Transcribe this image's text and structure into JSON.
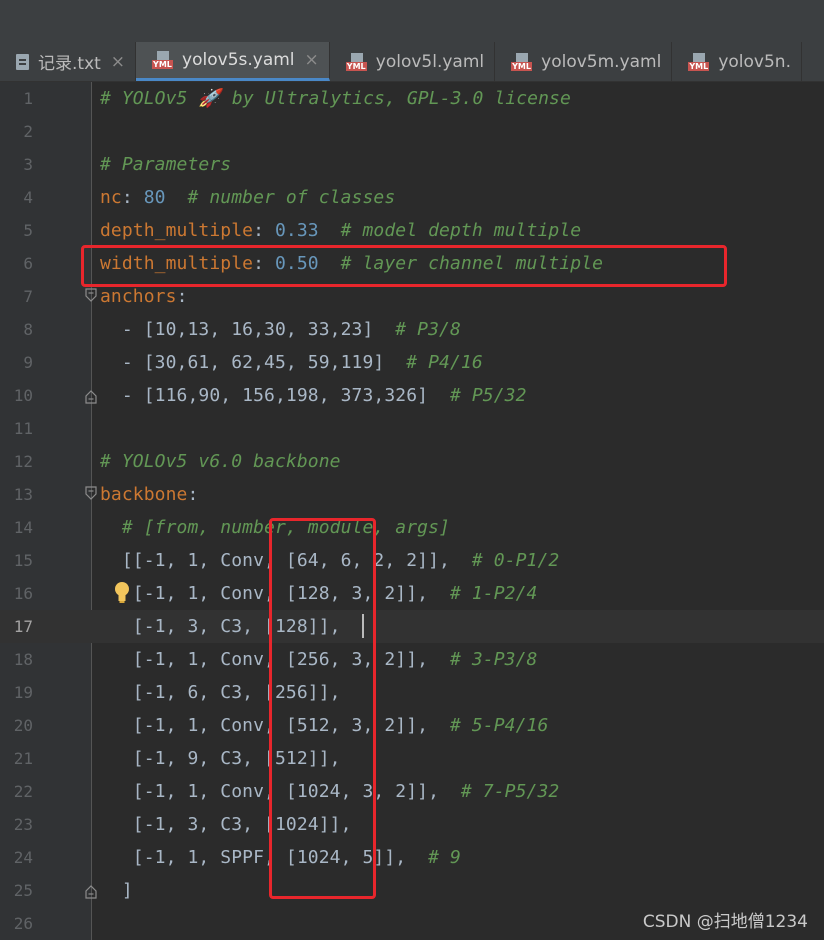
{
  "tabs": [
    {
      "name": "记录.txt",
      "icon": "text-file-icon",
      "active": false,
      "close": "×"
    },
    {
      "name": "yolov5s.yaml",
      "icon": "yaml-file-icon",
      "active": true,
      "close": "×"
    },
    {
      "name": "yolov5l.yaml",
      "icon": "yaml-file-icon",
      "active": false,
      "close": ""
    },
    {
      "name": "yolov5m.yaml",
      "icon": "yaml-file-icon",
      "active": false,
      "close": ""
    },
    {
      "name": "yolov5n.",
      "icon": "yaml-file-icon",
      "active": false,
      "close": ""
    }
  ],
  "yaml_badge": "YML",
  "current_line": 17,
  "lines": [
    {
      "n": "1",
      "tokens": [
        [
          "c",
          "# YOLOv5 🚀 by Ultralytics, GPL-3.0 license"
        ]
      ]
    },
    {
      "n": "2",
      "tokens": []
    },
    {
      "n": "3",
      "tokens": [
        [
          "c",
          "# Parameters"
        ]
      ]
    },
    {
      "n": "4",
      "tokens": [
        [
          "k",
          "nc"
        ],
        [
          "t",
          ": "
        ],
        [
          "n",
          "80"
        ],
        [
          "t",
          "  "
        ],
        [
          "c",
          "# number of classes"
        ]
      ]
    },
    {
      "n": "5",
      "tokens": [
        [
          "k",
          "depth_multiple"
        ],
        [
          "t",
          ": "
        ],
        [
          "n",
          "0.33"
        ],
        [
          "t",
          "  "
        ],
        [
          "c",
          "# model depth multiple"
        ]
      ]
    },
    {
      "n": "6",
      "tokens": [
        [
          "k",
          "width_multiple"
        ],
        [
          "t",
          ": "
        ],
        [
          "n",
          "0.50"
        ],
        [
          "t",
          "  "
        ],
        [
          "c",
          "# layer channel multiple"
        ]
      ]
    },
    {
      "n": "7",
      "tokens": [
        [
          "k",
          "anchors"
        ],
        [
          "t",
          ":"
        ]
      ],
      "fold": "open"
    },
    {
      "n": "8",
      "tokens": [
        [
          "t",
          "  - [10,13, 16,30, 33,23]  "
        ],
        [
          "c",
          "# P3/8"
        ]
      ]
    },
    {
      "n": "9",
      "tokens": [
        [
          "t",
          "  - [30,61, 62,45, 59,119]  "
        ],
        [
          "c",
          "# P4/16"
        ]
      ]
    },
    {
      "n": "10",
      "tokens": [
        [
          "t",
          "  - [116,90, 156,198, 373,326]  "
        ],
        [
          "c",
          "# P5/32"
        ]
      ],
      "fold": "close"
    },
    {
      "n": "11",
      "tokens": []
    },
    {
      "n": "12",
      "tokens": [
        [
          "c",
          "# YOLOv5 v6.0 backbone"
        ]
      ]
    },
    {
      "n": "13",
      "tokens": [
        [
          "k",
          "backbone"
        ],
        [
          "t",
          ":"
        ]
      ],
      "fold": "open"
    },
    {
      "n": "14",
      "tokens": [
        [
          "t",
          "  "
        ],
        [
          "c",
          "# [from, number, module, args]"
        ]
      ]
    },
    {
      "n": "15",
      "tokens": [
        [
          "t",
          "  [[-1, 1, Conv, [64, 6, 2, 2]],  "
        ],
        [
          "c",
          "# 0-P1/2"
        ]
      ]
    },
    {
      "n": "16",
      "tokens": [
        [
          "t",
          "   [-1, 1, Conv, [128, 3, 2]],  "
        ],
        [
          "c",
          "# 1-P2/4"
        ]
      ],
      "bulb": true
    },
    {
      "n": "17",
      "tokens": [
        [
          "t",
          "   [-1, 3, C3, [128]],"
        ]
      ],
      "caret": true
    },
    {
      "n": "18",
      "tokens": [
        [
          "t",
          "   [-1, 1, Conv, [256, 3, 2]],  "
        ],
        [
          "c",
          "# 3-P3/8"
        ]
      ]
    },
    {
      "n": "19",
      "tokens": [
        [
          "t",
          "   [-1, 6, C3, [256]],"
        ]
      ]
    },
    {
      "n": "20",
      "tokens": [
        [
          "t",
          "   [-1, 1, Conv, [512, 3, 2]],  "
        ],
        [
          "c",
          "# 5-P4/16"
        ]
      ]
    },
    {
      "n": "21",
      "tokens": [
        [
          "t",
          "   [-1, 9, C3, [512]],"
        ]
      ]
    },
    {
      "n": "22",
      "tokens": [
        [
          "t",
          "   [-1, 1, Conv, [1024, 3, 2]],  "
        ],
        [
          "c",
          "# 7-P5/32"
        ]
      ]
    },
    {
      "n": "23",
      "tokens": [
        [
          "t",
          "   [-1, 3, C3, [1024]],"
        ]
      ]
    },
    {
      "n": "24",
      "tokens": [
        [
          "t",
          "   [-1, 1, SPPF, [1024, 5]],  "
        ],
        [
          "c",
          "# 9"
        ]
      ]
    },
    {
      "n": "25",
      "tokens": [
        [
          "t",
          "  ]"
        ]
      ],
      "fold": "close"
    },
    {
      "n": "26",
      "tokens": []
    }
  ],
  "watermark": "CSDN @扫地僧1234",
  "colors": {
    "background": "#2b2b2b",
    "gutter": "#313335",
    "comment": "#629755",
    "key": "#cc7832",
    "number": "#6897bb",
    "text": "#a9b7c6",
    "highlight_box": "#e8262c"
  }
}
